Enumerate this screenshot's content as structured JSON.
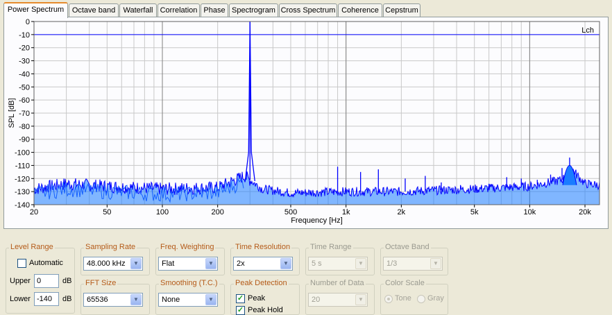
{
  "tabs": [
    {
      "label": "Power Spectrum",
      "active": true
    },
    {
      "label": "Octave band"
    },
    {
      "label": "Waterfall"
    },
    {
      "label": "Correlation"
    },
    {
      "label": "Phase"
    },
    {
      "label": "Spectrogram"
    },
    {
      "label": "Cross Spectrum"
    },
    {
      "label": "Coherence"
    },
    {
      "label": "Cepstrum"
    }
  ],
  "chart_data": {
    "type": "line",
    "xlabel": "Frequency [Hz]",
    "ylabel": "SPL [dB]",
    "x_scale": "log",
    "xlim": [
      20,
      24000
    ],
    "ylim": [
      -140,
      0
    ],
    "x_ticks": [
      "20",
      "50",
      "100",
      "200",
      "500",
      "1k",
      "2k",
      "5k",
      "10k",
      "20k"
    ],
    "y_ticks": [
      "0",
      "-10",
      "-20",
      "-30",
      "-40",
      "-50",
      "-60",
      "-70",
      "-80",
      "-90",
      "-100",
      "-110",
      "-120",
      "-130",
      "-140"
    ],
    "grid": true,
    "legend": "top-right",
    "level_line": -10,
    "series": [
      {
        "name": "Lch",
        "color": "#0000ff",
        "peaks": [
          {
            "x": 300,
            "y": 0
          },
          {
            "x": 900,
            "y": -111
          },
          {
            "x": 1200,
            "y": -115
          },
          {
            "x": 1500,
            "y": -113
          },
          {
            "x": 2100,
            "y": -120
          },
          {
            "x": 2700,
            "y": -118
          },
          {
            "x": 3300,
            "y": -123
          },
          {
            "x": 4200,
            "y": -125
          },
          {
            "x": 6000,
            "y": -124
          },
          {
            "x": 7500,
            "y": -119
          },
          {
            "x": 9000,
            "y": -120
          },
          {
            "x": 11000,
            "y": -121
          },
          {
            "x": 13000,
            "y": -117
          },
          {
            "x": 15000,
            "y": -112
          },
          {
            "x": 16500,
            "y": -104
          }
        ],
        "floor": [
          {
            "x": 20,
            "y": -128
          },
          {
            "x": 30,
            "y": -124
          },
          {
            "x": 50,
            "y": -126
          },
          {
            "x": 100,
            "y": -128
          },
          {
            "x": 200,
            "y": -127
          },
          {
            "x": 280,
            "y": -118
          },
          {
            "x": 350,
            "y": -128
          },
          {
            "x": 500,
            "y": -131
          },
          {
            "x": 1000,
            "y": -130
          },
          {
            "x": 2000,
            "y": -130
          },
          {
            "x": 5000,
            "y": -128
          },
          {
            "x": 10000,
            "y": -126
          },
          {
            "x": 15000,
            "y": -121
          },
          {
            "x": 17000,
            "y": -113
          },
          {
            "x": 20000,
            "y": -124
          },
          {
            "x": 24000,
            "y": -125
          }
        ]
      }
    ]
  },
  "controls": {
    "level_range": {
      "title": "Level Range",
      "automatic_label": "Automatic",
      "automatic": false,
      "upper_label": "Upper",
      "upper_value": "0",
      "lower_label": "Lower",
      "lower_value": "-140",
      "unit": "dB"
    },
    "sampling_rate": {
      "title": "Sampling Rate",
      "value": "48.000 kHz"
    },
    "fft_size": {
      "title": "FFT Size",
      "value": "65536"
    },
    "freq_weighting": {
      "title": "Freq. Weighting",
      "value": "Flat"
    },
    "smoothing": {
      "title": "Smoothing (T.C.)",
      "value": "None"
    },
    "time_resolution": {
      "title": "Time Resolution",
      "value": "2x"
    },
    "peak_detection": {
      "title": "Peak Detection",
      "peak_label": "Peak",
      "peak_checked": true,
      "peak_hold_label": "Peak Hold",
      "peak_hold_checked": true
    },
    "time_range": {
      "title": "Time Range",
      "value": "5 s"
    },
    "number_of_data": {
      "title": "Number of Data",
      "value": "20"
    },
    "octave_band": {
      "title": "Octave Band",
      "value": "1/3"
    },
    "color_scale": {
      "title": "Color Scale",
      "tone_label": "Tone",
      "gray_label": "Gray",
      "selected": "Tone"
    }
  }
}
